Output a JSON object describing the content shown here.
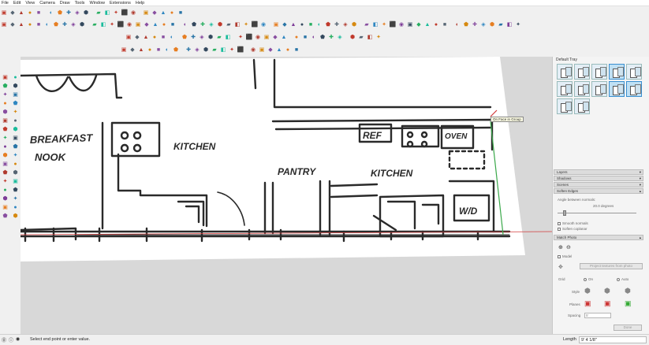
{
  "menu": [
    "File",
    "Edit",
    "View",
    "Camera",
    "Draw",
    "Tools",
    "Window",
    "Extensions",
    "Help"
  ],
  "toolbar_icons": {
    "row1": [
      "new-icon",
      "open-icon",
      "save-icon",
      "cut-icon",
      "copy-icon",
      "paste-icon",
      "erase-icon",
      "undo-icon",
      "redo-icon",
      "print-icon",
      "model-info-icon",
      "camera-icon",
      "pan-icon",
      "zoom-icon",
      "zoom-extents-icon",
      "previous-view-icon",
      "section-icon",
      "warehouse-icon",
      "info-icon",
      "tools-icon"
    ],
    "row2": [
      "select-icon",
      "component-icon",
      "paint-icon",
      "eraser-icon",
      "line-icon",
      "arc-icon",
      "rectangle-icon",
      "circle-icon",
      "polygon-icon",
      "freehand-icon",
      "move-icon",
      "pushpull-icon",
      "rotate-icon",
      "followme-icon",
      "scale-icon",
      "offset-icon",
      "tape-icon",
      "dimension-icon",
      "protractor-icon",
      "text-icon",
      "axes-icon",
      "3dtext-icon",
      "orbit-icon",
      "pan2-icon",
      "zoom2-icon",
      "zoom-window-icon",
      "zoom-ext2-icon",
      "position-camera-icon",
      "walk-icon",
      "lookaround-icon",
      "section-plane-icon",
      "iso-view-icon",
      "top-view-icon",
      "front-view-icon",
      "right-view-icon",
      "back-view-icon",
      "left-view-icon",
      "xray-icon",
      "back-edges-icon",
      "wireframe-icon",
      "hidden-line-icon",
      "shaded-icon",
      "textured-icon",
      "monochrome-icon",
      "sandbox-icon",
      "smoove-icon",
      "stamp-icon",
      "drape-icon",
      "add-detail-icon",
      "flip-edge-icon",
      "shadow-icon",
      "fog-icon",
      "match-photo-icon",
      "record-icon",
      "stop-icon",
      "sun-icon",
      "location-icon",
      "terrain-icon"
    ],
    "row3": [
      "dynamic-comp-icon",
      "interact-icon",
      "options-icon",
      "attributes-icon",
      "solid-union-icon",
      "solid-subtract-icon",
      "solid-trim-icon",
      "solid-intersect-icon",
      "outer-shell-icon",
      "split-icon",
      "warehouse-share-icon",
      "ext-warehouse-icon",
      "play-icon",
      "stop-icon",
      "scene-icon",
      "layer-icon",
      "gear-icon",
      "diamond-icon",
      "chevron-icon",
      "path-icon",
      "wave-icon",
      "cross-icon",
      "check-icon",
      "cube-icon",
      "styles-icon",
      "ruby-icon",
      "component-options-icon",
      "export-icon"
    ],
    "row4": [
      "circle-slash-icon",
      "camera-orbit-icon",
      "iso-icon",
      "top-icon",
      "front-icon",
      "right-icon",
      "back-icon",
      "left-icon",
      "bottom-icon",
      "perspective-icon",
      "two-point-icon",
      "parallel-icon",
      "fog-icon",
      "edge-style-icon",
      "face-style-icon",
      "sun-shadow-icon",
      "section-fill-icon",
      "section-cut-icon",
      "hidden-geometry-icon",
      "guides-icon"
    ]
  },
  "left_tools": [
    "select-icon",
    "component-icon",
    "paint-icon",
    "eraser-icon",
    "line-icon",
    "freehand-icon",
    "rectangle-icon",
    "rotated-rect-icon",
    "circle-icon",
    "polygon-icon",
    "arc-icon",
    "pie-icon",
    "move-icon",
    "pushpull-icon",
    "rotate-icon",
    "followme-icon",
    "scale-icon",
    "offset-icon",
    "tape-icon",
    "dimension-icon",
    "protractor-icon",
    "text-icon",
    "axes-icon",
    "3dtext-icon",
    "orbit-icon",
    "pan-icon",
    "zoom-icon",
    "zoom-window-icon",
    "zoom-extents-icon",
    "previous-icon",
    "position-camera-icon",
    "walk-icon",
    "look-icon",
    "section-icon"
  ],
  "viewport": {
    "labels": {
      "breakfast_nook_1": "BREAKFAST",
      "breakfast_nook_2": "NOOK",
      "kitchen_left": "KITCHEN",
      "pantry": "PANTRY",
      "kitchen_right": "KITCHEN",
      "ref": "REF",
      "oven": "OVEN",
      "wd": "W/D"
    },
    "tooltip": "On Face in Group"
  },
  "tray": {
    "title": "Default Tray",
    "panels": [
      {
        "label": "Layers"
      },
      {
        "label": "Shadows"
      },
      {
        "label": "Scenes"
      },
      {
        "label": "Soften Edges"
      }
    ],
    "soften": {
      "angle_label": "Angle between normals:",
      "angle_value": "20.0  degrees",
      "smooth_normals": "Smooth normals",
      "soften_coplanar": "Soften coplanar"
    },
    "match_photo": {
      "label": "Match Photo",
      "model_label": "Model",
      "project_button": "Project textures from photo",
      "grid_label": "Grid",
      "grid_on": "On",
      "grid_auto": "Auto",
      "style_label": "Style",
      "planes_label": "Planes",
      "spacing_label": "Spacing",
      "spacing_value": "5'",
      "done_button": "Done"
    }
  },
  "status": {
    "message": "Select end point or enter value.",
    "measurement_label": "Length",
    "measurement_value": "9' 4 1/8\""
  },
  "colors": {
    "background": "#f0f0f0",
    "viewport_bg": "#d8d8d8",
    "paper": "#ffffff",
    "sketch": "#2a2a2a",
    "axis_red": "#d23a3a",
    "axis_green": "#3aa84a"
  }
}
